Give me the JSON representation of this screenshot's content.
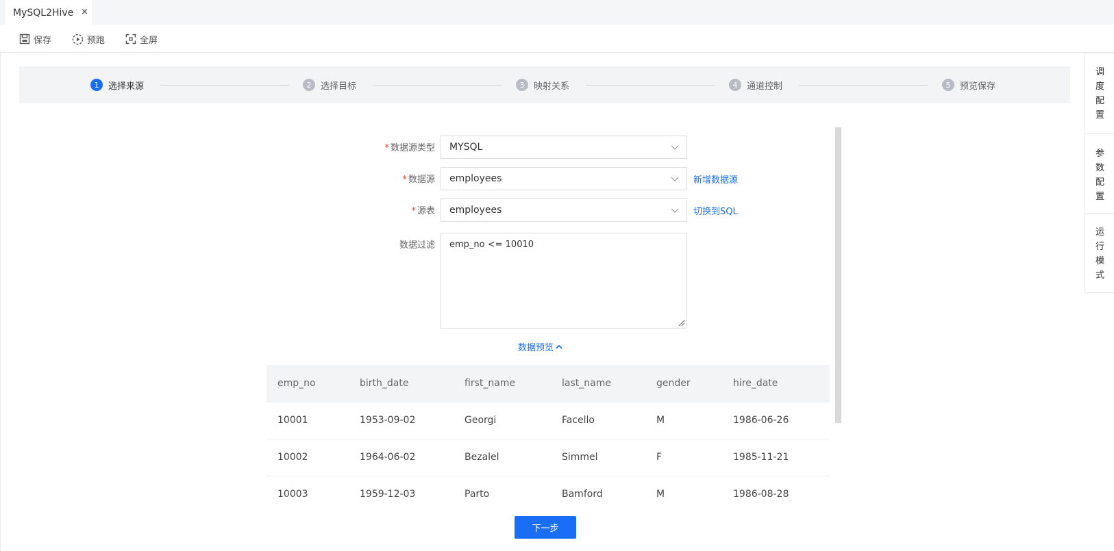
{
  "tabs": [
    {
      "label": "MySQL2Hive",
      "close": "×"
    }
  ],
  "toolbar": {
    "save": "保存",
    "prerun": "预跑",
    "fullscreen": "全屏"
  },
  "steps": [
    {
      "num": "1",
      "label": "选择来源"
    },
    {
      "num": "2",
      "label": "选择目标"
    },
    {
      "num": "3",
      "label": "映射关系"
    },
    {
      "num": "4",
      "label": "通道控制"
    },
    {
      "num": "5",
      "label": "预览保存"
    }
  ],
  "form": {
    "datasource_type": {
      "label": "数据源类型",
      "value": "MYSQL"
    },
    "datasource": {
      "label": "数据源",
      "value": "employees",
      "link": "新增数据源"
    },
    "source_table": {
      "label": "源表",
      "value": "employees",
      "link": "切换到SQL"
    },
    "filter": {
      "label": "数据过滤",
      "value": "emp_no <= 10010"
    },
    "required_mark": "*"
  },
  "preview": {
    "toggle": "数据预览",
    "columns": [
      "emp_no",
      "birth_date",
      "first_name",
      "last_name",
      "gender",
      "hire_date"
    ],
    "rows": [
      [
        "10001",
        "1953-09-02",
        "Georgi",
        "Facello",
        "M",
        "1986-06-26"
      ],
      [
        "10002",
        "1964-06-02",
        "Bezalel",
        "Simmel",
        "F",
        "1985-11-21"
      ],
      [
        "10003",
        "1959-12-03",
        "Parto",
        "Bamford",
        "M",
        "1986-08-28"
      ]
    ]
  },
  "next_button": "下一步",
  "side_panel": {
    "items": [
      {
        "chars": [
          "调",
          "度",
          "配",
          "置"
        ]
      },
      {
        "chars": [
          "参",
          "数",
          "配",
          "置"
        ]
      },
      {
        "chars": [
          "运",
          "行",
          "模",
          "式"
        ]
      }
    ]
  },
  "colors": {
    "accent": "#1a6ef5",
    "required": "#f04134"
  }
}
